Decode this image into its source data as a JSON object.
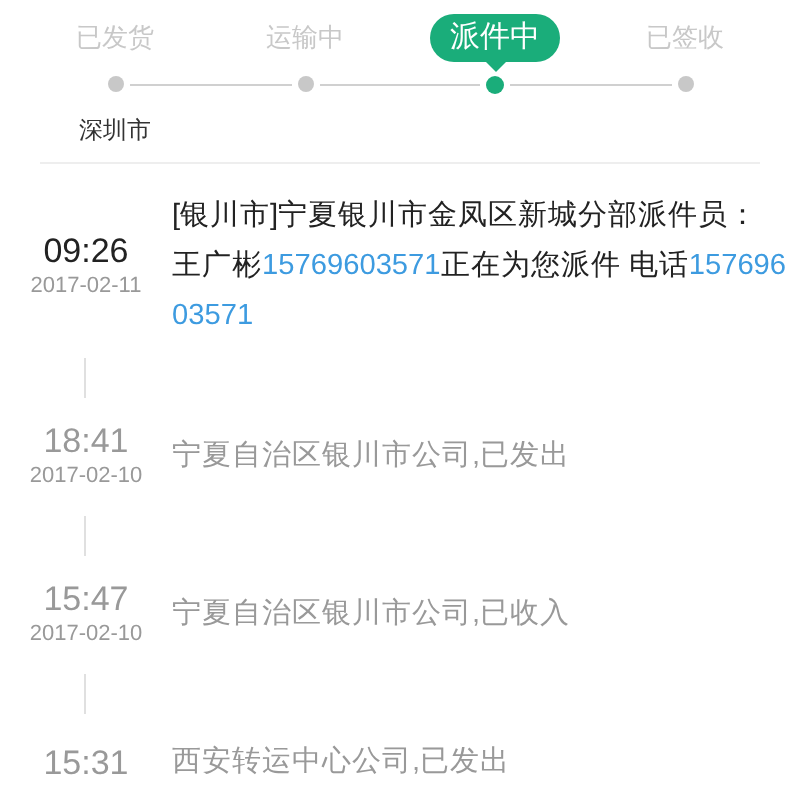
{
  "steps": [
    {
      "label": "已发货",
      "selected": false,
      "location": "深圳市"
    },
    {
      "label": "运输中",
      "selected": false
    },
    {
      "label": "派件中",
      "selected": true
    },
    {
      "label": "已签收",
      "selected": false
    }
  ],
  "events": [
    {
      "time": "09:26",
      "date": "2017-02-11",
      "segments": [
        {
          "kind": "plain",
          "text": "[银川市]宁夏银川市金凤区新城分部派件员：王广彬"
        },
        {
          "kind": "phone",
          "text": "15769603571"
        },
        {
          "kind": "plain",
          "text": "正在为您派件 电话"
        },
        {
          "kind": "phone",
          "text": "15769603571"
        }
      ]
    },
    {
      "time": "18:41",
      "date": "2017-02-10",
      "segments": [
        {
          "kind": "plain",
          "text": "宁夏自治区银川市公司,已发出"
        }
      ]
    },
    {
      "time": "15:47",
      "date": "2017-02-10",
      "segments": [
        {
          "kind": "plain",
          "text": "宁夏自治区银川市公司,已收入"
        }
      ]
    },
    {
      "time": "15:31",
      "segments": [
        {
          "kind": "plain",
          "text": "西安转运中心公司,已发出"
        }
      ]
    }
  ]
}
